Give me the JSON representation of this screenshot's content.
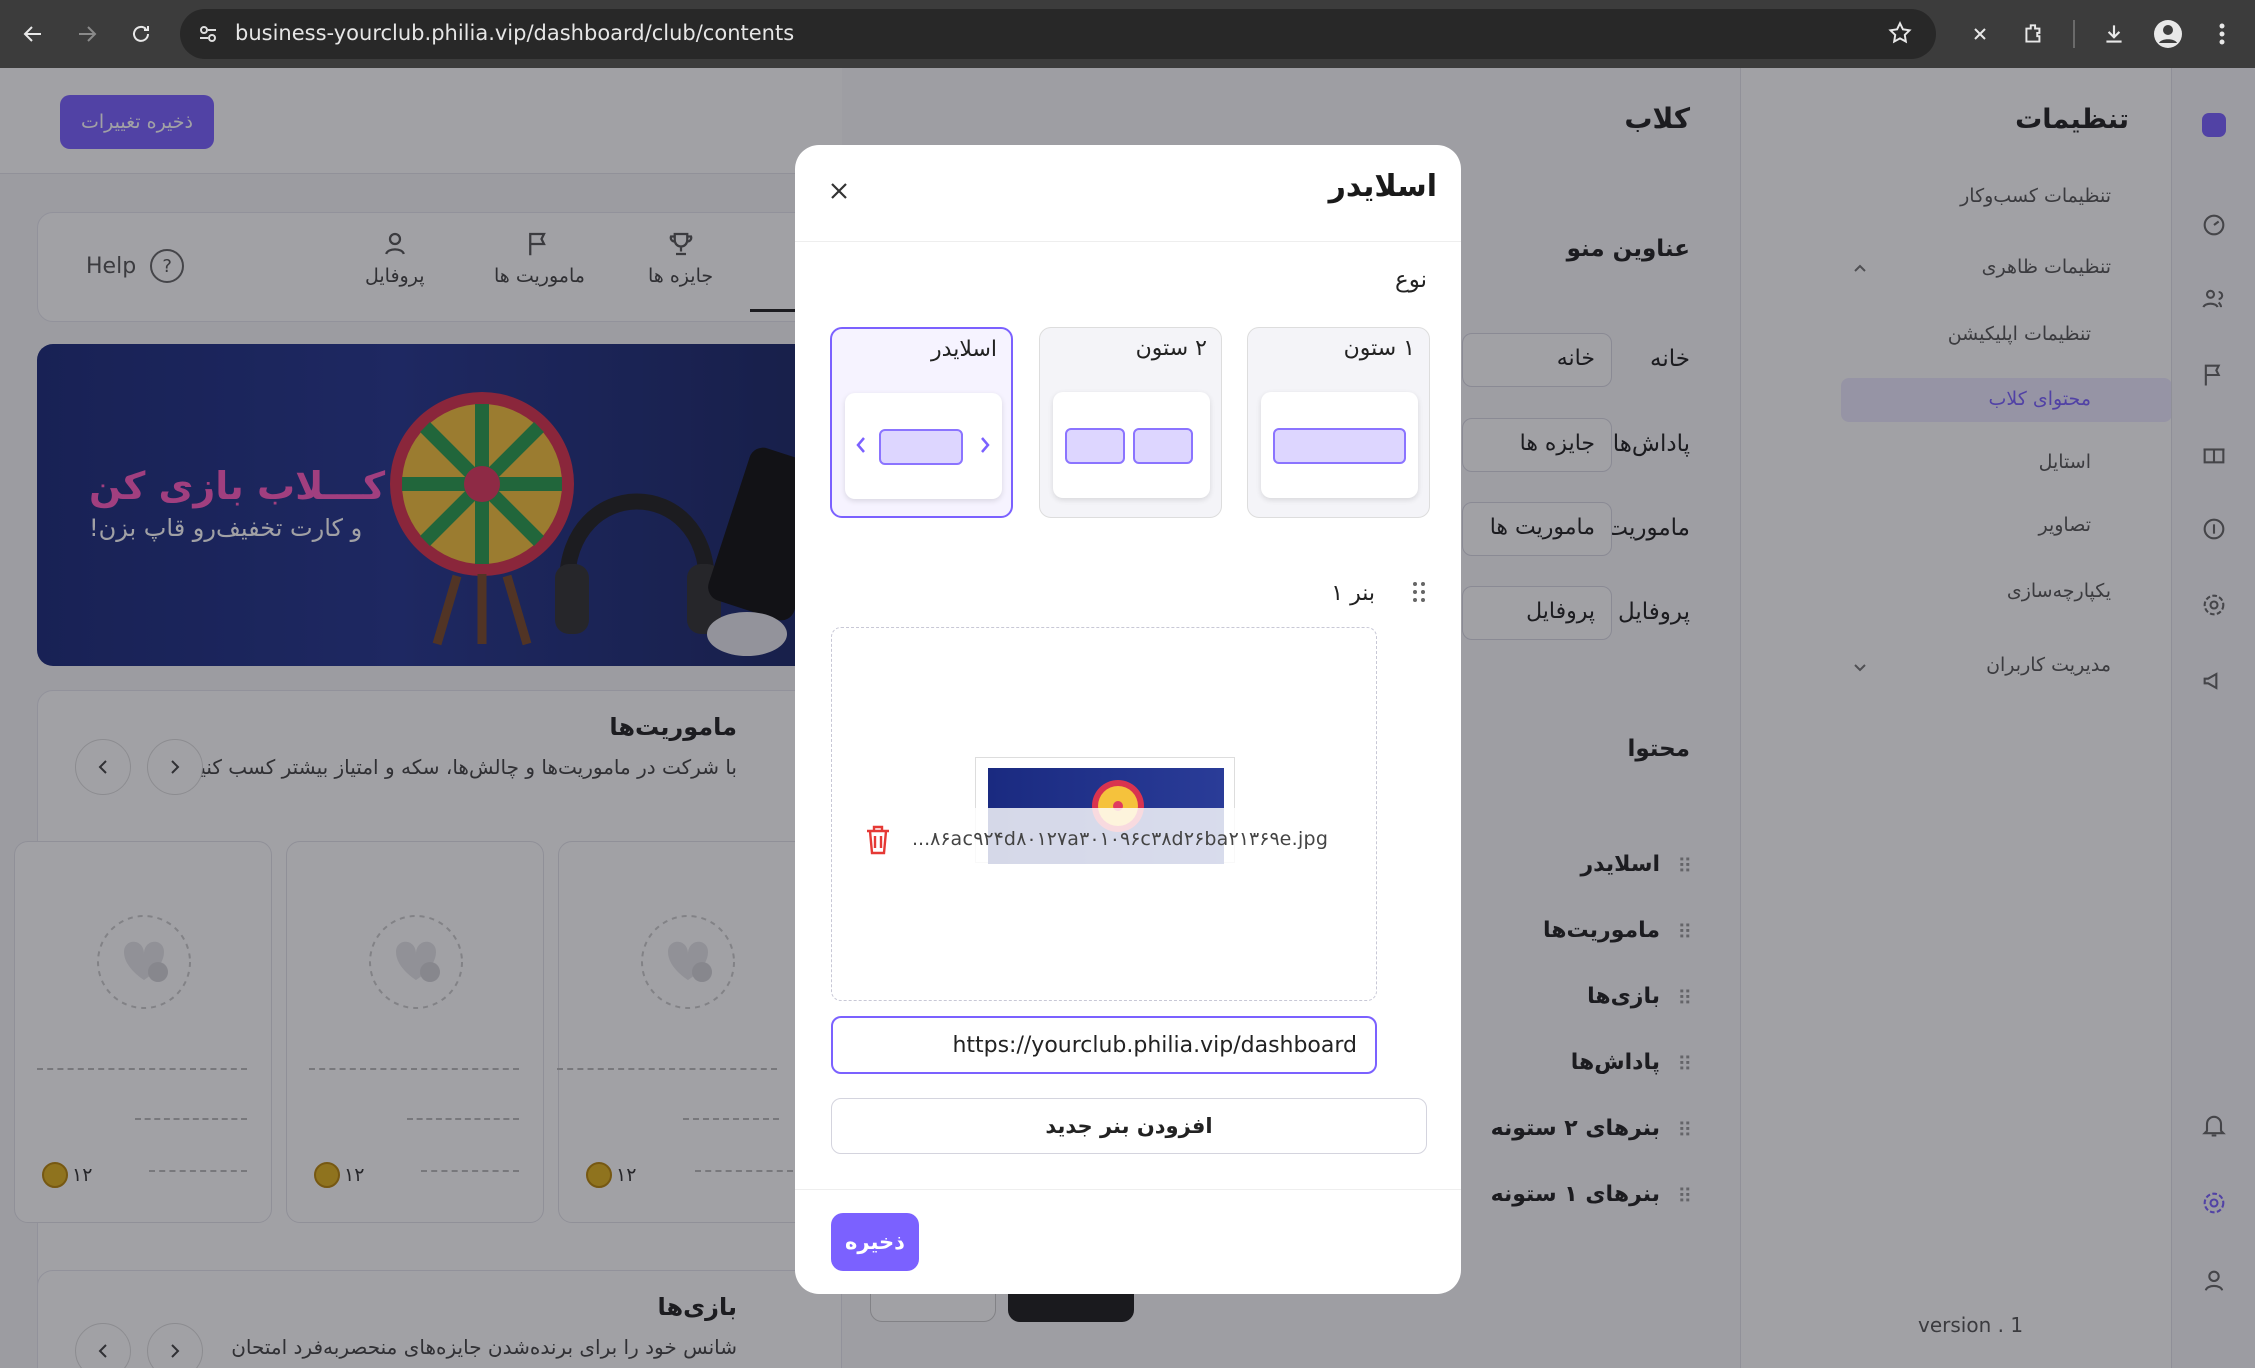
{
  "browser": {
    "url": "business-yourclub.philia.vip/dashboard/club/contents",
    "icons": [
      "back-icon",
      "forward-icon",
      "reload-icon",
      "site-info-icon",
      "bookmark-star-icon",
      "close-tab-icon",
      "extensions-icon",
      "download-icon",
      "profile-icon",
      "menu-icon"
    ]
  },
  "sidebar": {
    "title": "تنظیمات",
    "items": [
      {
        "label": "تنظیمات کسب‌وکار"
      },
      {
        "label": "تنظیمات ظاهری"
      },
      {
        "label": "تنظیمات اپلیکیشن"
      },
      {
        "label": "محتوای کلاب",
        "active": true
      },
      {
        "label": "استایل"
      },
      {
        "label": "تصاویر"
      },
      {
        "label": "یکپارچه‌سازی"
      },
      {
        "label": "مدیریت کاربران"
      }
    ],
    "version": "version . 1"
  },
  "club": {
    "title": "کلاب",
    "menu_titles_heading": "عناوین منو",
    "menu_rows": [
      {
        "label": "خانه",
        "value": "خانه"
      },
      {
        "label": "پاداش‌ها",
        "value": "جایزه ها"
      },
      {
        "label": "ماموریت‌ها",
        "value": "ماموریت ها"
      },
      {
        "label": "پروفایل",
        "value": "پروفایل"
      }
    ],
    "content_heading": "محتوا",
    "content_items": [
      "اسلایدر",
      "ماموریت‌ها",
      "بازی‌ها",
      "پاداش‌ها",
      "بنرهای ۲ ستونه",
      "بنرهای ۱ ستونه"
    ]
  },
  "preview": {
    "save_changes": "ذخیره تغییرات",
    "tabs": [
      "جایزه ها",
      "ماموریت ها",
      "پروفایل"
    ],
    "help": "Help",
    "banner_line1": "تو کـــلاب بازی کن",
    "banner_line2": "و کارت تخفیف‌رو قاپ بزن!",
    "missions_title": "ماموریت‌ها",
    "missions_desc": "با شرکت در ماموریت‌ها و چالش‌ها، سکه و امتیاز بیشتر کسب کنید",
    "card_coin": "۱۲",
    "games_title": "بازی‌ها",
    "games_desc": "شانس خود را برای برنده‌شدن جایزه‌های منحصربه‌فرد امتحان"
  },
  "modal": {
    "title": "اسلایدر",
    "type_label": "نوع",
    "options": [
      {
        "label": "اسلایدر",
        "selected": true
      },
      {
        "label": "۲ ستون",
        "selected": false
      },
      {
        "label": "۱ ستون",
        "selected": false
      }
    ],
    "banner_label": "بنر ۱",
    "file_name": "...۸۶ac۹۲۴d۸۰۱۲۷a۳۰۱۰۹۶c۳۸d۲۶ba۲۱۳۶۹e.jpg",
    "link_value": "https://yourclub.philia.vip/dashboard",
    "add_banner": "افزودن بنر جدید",
    "save": "ذخیره"
  },
  "colors": {
    "accent": "#7b61ff",
    "chrome_bg": "#3c3c3c",
    "danger": "#e53935"
  }
}
